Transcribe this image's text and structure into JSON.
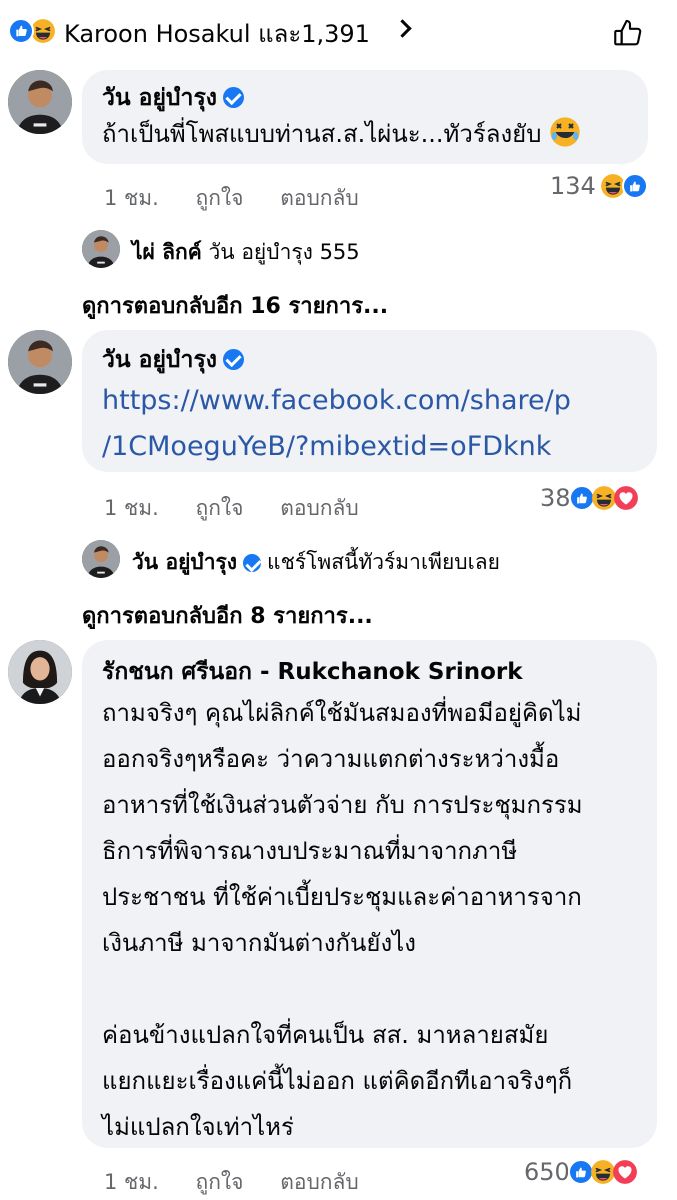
{
  "top": {
    "reactors_text": "Karoon Hosakul และ1,391",
    "icons": [
      "like-icon",
      "haha-icon",
      "thumbs-up-outline-icon"
    ]
  },
  "comments": [
    {
      "author": "วัน อยู่บำรุง",
      "verified": true,
      "text": "ถ้าเป็นพี่โพสแบบท่านส.ส.ไผ่นะ...ทัวร์ลงยับ",
      "time": "1 ชม.",
      "like_label": "ถูกใจ",
      "reply_label": "ตอบกลับ",
      "reaction_count": "134",
      "reply_preview": {
        "author": "ไผ่ ลิกค์",
        "text": "วัน อยู่บำรุง 555"
      },
      "more_replies": "ดูการตอบกลับอีก 16 รายการ..."
    },
    {
      "author": "วัน อยู่บำรุง",
      "verified": true,
      "link_line1": "https://www.facebook.com/share/p",
      "link_line2": "/1CMoeguYeB/?mibextid=oFDknk",
      "time": "1 ชม.",
      "like_label": "ถูกใจ",
      "reply_label": "ตอบกลับ",
      "reaction_count": "38",
      "reply_preview": {
        "author": "วัน อยู่บำรุง",
        "text": "แชร์โพสนี้ทัวร์มาเพียบเลย"
      },
      "more_replies": "ดูการตอบกลับอีก 8 รายการ..."
    },
    {
      "author": "รักชนก ศรีนอก - Rukchanok Srinork",
      "lines": [
        "ถามจริงๆ คุณไผ่ลิกค์ใช้มันสมองที่พอมีอยู่คิดไม่",
        "ออกจริงๆหรือคะ ว่าความแตกต่างระหว่างมื้อ",
        "อาหารที่ใช้เงินส่วนตัวจ่าย กับ การประชุมกรรม",
        "ธิการที่พิจารณางบประมาณที่มาจากภาษี",
        "ประชาชน ที่ใช้ค่าเบี้ยประชุมและค่าอาหารจาก",
        "เงินภาษี มาจากมันต่างกันยังไง",
        "",
        "ค่อนข้างแปลกใจที่คนเป็น สส. มาหลายสมัย",
        "แยกแยะเรื่องแค่นี้ไม่ออก แต่คิดอีกทีเอาจริงๆก็",
        "ไม่แปลกใจเท่าไหร่"
      ],
      "time": "1 ชม.",
      "like_label": "ถูกใจ",
      "reply_label": "ตอบกลับ",
      "reaction_count": "650"
    }
  ],
  "colors": {
    "like": "#1877f2",
    "haha": "#f7b125",
    "love": "#f33e58",
    "bubble": "#f0f2f5",
    "link": "#2a58a6",
    "meta": "#65676b"
  }
}
